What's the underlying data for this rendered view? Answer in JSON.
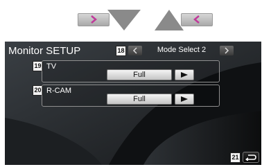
{
  "screen": {
    "title": "Monitor SETUP",
    "mode_label": "Mode Select 2"
  },
  "callouts": {
    "mode_select": "18",
    "tv": "19",
    "rcam": "20",
    "return": "21"
  },
  "settings": [
    {
      "label": "TV",
      "value": "Full"
    },
    {
      "label": "R-CAM",
      "value": "Full"
    }
  ],
  "icons": {
    "page_prev": "chevron-right-icon",
    "page_down": "triangle-down-icon",
    "page_up": "triangle-up-icon",
    "page_next": "chevron-left-icon",
    "mode_prev": "chevron-left-icon",
    "mode_next": "chevron-right-icon",
    "setting_arrow": "play-arrow-icon",
    "return": "return-icon"
  },
  "colors": {
    "nav_arrow": "#c0399a",
    "triangle": "#8a8a8a",
    "screen_bg": "#0f1113",
    "text": "#ffffff"
  }
}
